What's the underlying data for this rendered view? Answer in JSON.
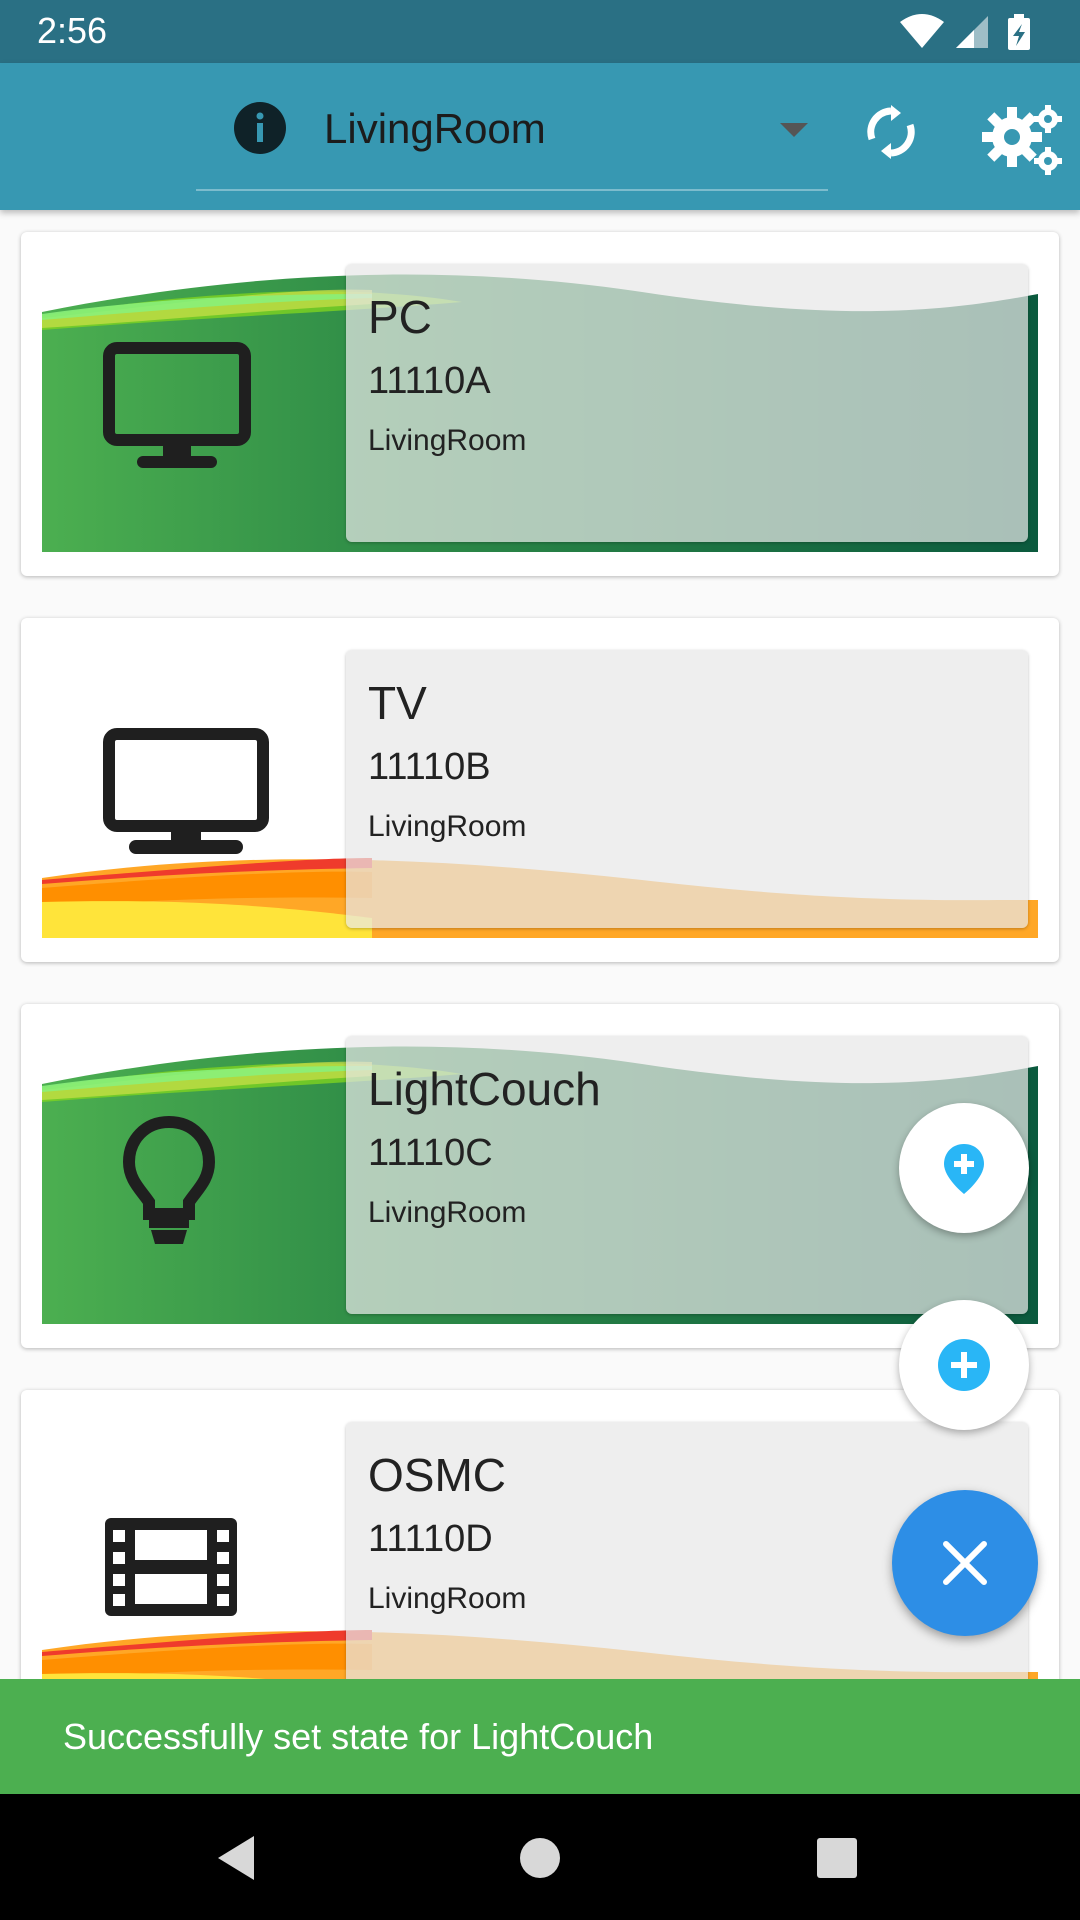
{
  "status_bar": {
    "time": "2:56",
    "icons": [
      "wifi-icon",
      "signal-icon",
      "battery-charging-icon"
    ]
  },
  "app_bar": {
    "selected_room": "LivingRoom",
    "icons": [
      "info-icon",
      "dropdown-arrow-icon",
      "sync-icon",
      "settings-gear-icon"
    ],
    "color": "#3798b2"
  },
  "devices": [
    {
      "name": "PC",
      "code": "11110A",
      "room": "LivingRoom",
      "icon": "monitor-icon",
      "wave": "green"
    },
    {
      "name": "TV",
      "code": "11110B",
      "room": "LivingRoom",
      "icon": "tv-icon",
      "wave": "orange"
    },
    {
      "name": "LightCouch",
      "code": "11110C",
      "room": "LivingRoom",
      "icon": "lightbulb-icon",
      "wave": "green"
    },
    {
      "name": "OSMC",
      "code": "11110D",
      "room": "LivingRoom",
      "icon": "film-icon",
      "wave": "orange"
    }
  ],
  "fab_menu": {
    "items": [
      "add-room-location-icon",
      "add-device-icon"
    ],
    "main_icon": "close-icon",
    "main_color": "#2d8ee6"
  },
  "snackbar": {
    "message": "Successfully set state for LightCouch",
    "color": "#4caf50"
  },
  "nav_bar": {
    "icons": [
      "back-icon",
      "home-icon",
      "recents-icon"
    ]
  }
}
